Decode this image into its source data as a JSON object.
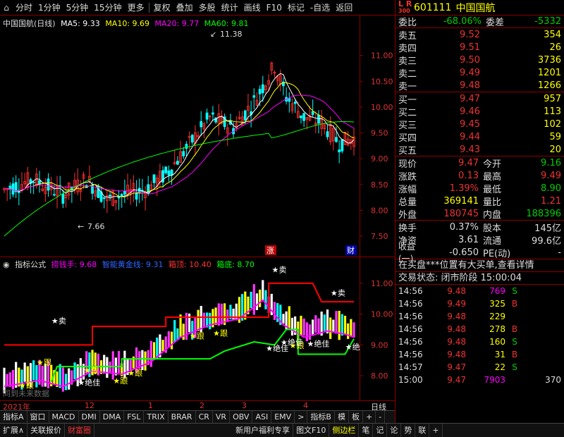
{
  "toolbar": {
    "items": [
      "分时",
      "1分钟",
      "5分钟",
      "15分钟",
      "更多",
      "复权",
      "叠加",
      "多股",
      "统计",
      "画线",
      "F10",
      "标记",
      "-自选",
      "返回"
    ]
  },
  "main_legend": {
    "title": "中国国航(日线)",
    "ma5": "MA5: 9.33",
    "ma10": "MA10: 9.69",
    "ma20": "MA20: 9.77",
    "ma60": "MA60: 9.81",
    "hi_label": "11.38",
    "lo_label": "7.66",
    "zhang": "涨",
    "cai": "财"
  },
  "ind_legend": {
    "title": "指标公式",
    "a": "捞钱手: 9.68",
    "b": "智能黄金线: 9.31",
    "c": "箱顶: 10.40",
    "d": "箱底: 8.70",
    "watermark": "同到未来数据",
    "signals": [
      "卖",
      "卖",
      "卖",
      "跟",
      "跟",
      "跟",
      "跟",
      "跟",
      "跟",
      "跟",
      "跟",
      "绝佳",
      "绝佳",
      "绝佳",
      "绝佳",
      "绝"
    ]
  },
  "colors": {
    "up": "#ff3030",
    "down": "#00ffff",
    "ma5": "#ffffff",
    "ma10": "#ffff00",
    "ma20": "#ff00ff",
    "ma60": "#00ff00",
    "box_top": "#ff0000",
    "box_bot": "#00ff00"
  },
  "chart_data": {
    "type": "candlestick",
    "price_axis": [
      "11.00",
      "10.50",
      "10.00",
      "9.50",
      "9.00",
      "8.50",
      "8.00",
      "7.50"
    ],
    "ind_axis": [
      "11.00",
      "10.00",
      "9.00",
      "8.00"
    ],
    "ylim": [
      7.2,
      11.5
    ],
    "ind_ylim": [
      7.5,
      11.5
    ]
  },
  "date_axis": {
    "labels": [
      "2021年",
      "12",
      "1",
      "2",
      "3",
      "4"
    ],
    "right": "日线"
  },
  "tabs1": [
    "指标A",
    "窗口",
    "MACD",
    "DMI",
    "DMA",
    "FSL",
    "TRIX",
    "BRAR",
    "CR",
    "VR",
    "OBV",
    "ASI",
    "EMV",
    ">",
    "指标B",
    "模",
    "板",
    "+",
    "-"
  ],
  "tabs2": [
    "扩展∧",
    "关联报价",
    "财富圈",
    "新用户福利专享",
    "图文F10",
    "侧边栏",
    "笔",
    "记",
    "论",
    "势",
    "联",
    "+"
  ],
  "stock": {
    "lr": "L R",
    "num": "300",
    "code": "601111",
    "name": "中国国航"
  },
  "weibi": {
    "label": "委比",
    "value": "-68.06%",
    "label2": "委差",
    "value2": "-5332"
  },
  "asks": [
    {
      "label": "卖五",
      "price": "9.52",
      "vol": "354"
    },
    {
      "label": "卖四",
      "price": "9.51",
      "vol": "26"
    },
    {
      "label": "卖三",
      "price": "9.50",
      "vol": "3736"
    },
    {
      "label": "卖二",
      "price": "9.49",
      "vol": "1201"
    },
    {
      "label": "卖一",
      "price": "9.48",
      "vol": "1266"
    }
  ],
  "bids": [
    {
      "label": "买一",
      "price": "9.47",
      "vol": "957"
    },
    {
      "label": "买二",
      "price": "9.46",
      "vol": "113"
    },
    {
      "label": "买三",
      "price": "9.45",
      "vol": "102"
    },
    {
      "label": "买四",
      "price": "9.44",
      "vol": "59"
    },
    {
      "label": "买五",
      "price": "9.43",
      "vol": "20"
    }
  ],
  "quote": [
    {
      "l1": "现价",
      "v1": "9.47",
      "c1": "#e33",
      "l2": "今开",
      "v2": "9.16",
      "c2": "#0c0"
    },
    {
      "l1": "涨跌",
      "v1": "0.13",
      "c1": "#e33",
      "l2": "最高",
      "v2": "9.49",
      "c2": "#e33"
    },
    {
      "l1": "涨幅",
      "v1": "1.39%",
      "c1": "#e33",
      "l2": "最低",
      "v2": "8.90",
      "c2": "#0c0"
    },
    {
      "l1": "总量",
      "v1": "369141",
      "c1": "#ff0",
      "l2": "量比",
      "v2": "1.21",
      "c2": "#e33"
    },
    {
      "l1": "外盘",
      "v1": "180745",
      "c1": "#e33",
      "l2": "内盘",
      "v2": "188396",
      "c2": "#0c0"
    }
  ],
  "quote2": [
    {
      "l1": "换手",
      "v1": "0.37%",
      "c1": "#ddd",
      "l2": "股本",
      "v2": "145亿",
      "c2": "#ddd"
    },
    {
      "l1": "净资",
      "v1": "3.61",
      "c1": "#ddd",
      "l2": "流通",
      "v2": "99.6亿",
      "c2": "#ddd"
    },
    {
      "l1": "收益(一)",
      "v1": "-0.650",
      "c1": "#ddd",
      "l2": "PE(动)",
      "v2": "-",
      "c2": "#ddd"
    }
  ],
  "info1": "在买盘***位置有大买单,查看详情",
  "info2": "交易状态: 闭市阶段  15:00:04",
  "ticks": [
    {
      "t": "14:56",
      "p": "9.48",
      "v": "769",
      "vc": "#f0f",
      "b": "S",
      "bc": "#0c0"
    },
    {
      "t": "14:56",
      "p": "9.49",
      "v": "325",
      "vc": "#ff0",
      "b": "B",
      "bc": "#e33"
    },
    {
      "t": "14:56",
      "p": "9.48",
      "v": "229",
      "vc": "#ff0",
      "b": "",
      "bc": "#ddd"
    },
    {
      "t": "14:56",
      "p": "9.48",
      "v": "278",
      "vc": "#ff0",
      "b": "B",
      "bc": "#e33"
    },
    {
      "t": "14:56",
      "p": "9.48",
      "v": "160",
      "vc": "#ff0",
      "b": "S",
      "bc": "#0c0"
    },
    {
      "t": "14:56",
      "p": "9.48",
      "v": "31",
      "vc": "#ff0",
      "b": "B",
      "bc": "#e33"
    },
    {
      "t": "14:57",
      "p": "9.47",
      "v": "22",
      "vc": "#ff0",
      "b": "S",
      "bc": "#0c0"
    },
    {
      "t": "15:00",
      "p": "9.47",
      "v": "7903",
      "vc": "#f0f",
      "b": "",
      "bc": "#ddd",
      "n": "370"
    }
  ]
}
